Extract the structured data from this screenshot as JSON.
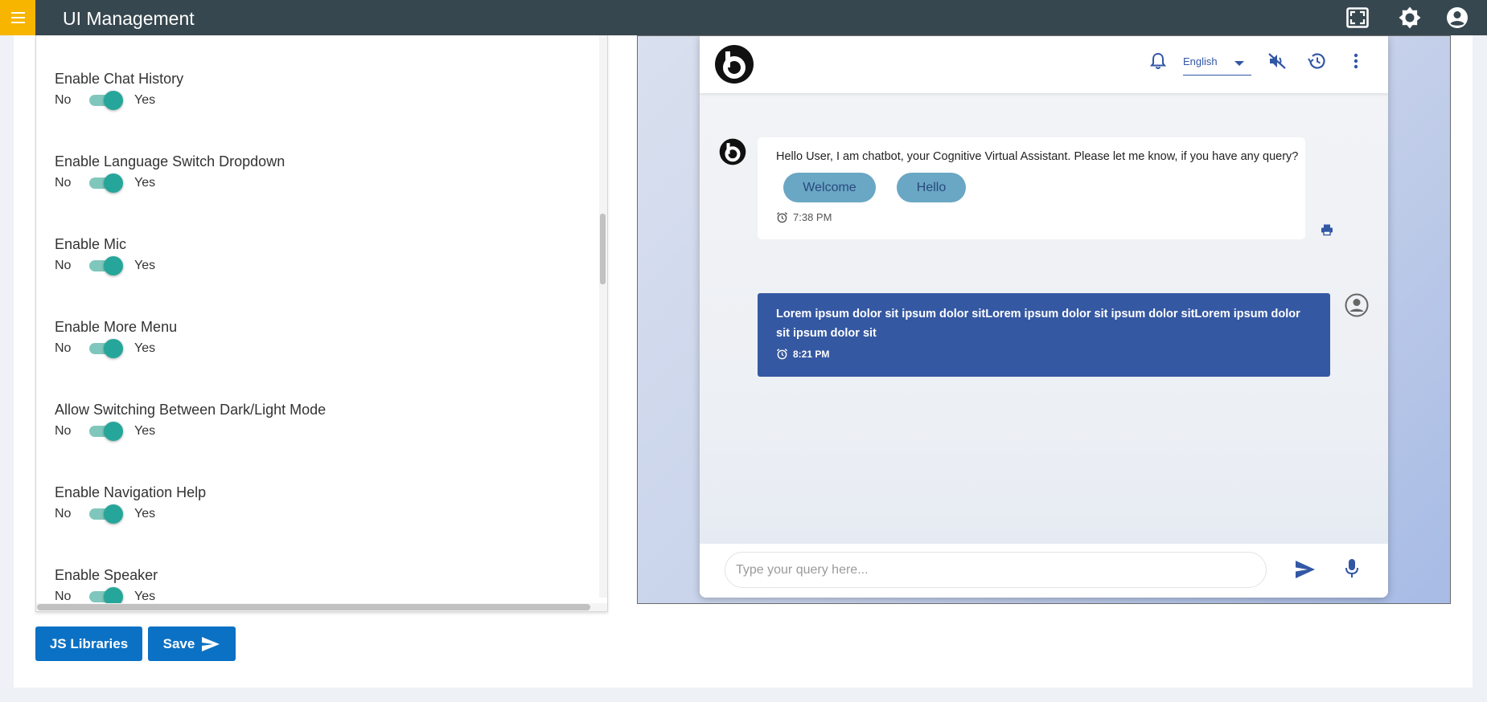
{
  "header": {
    "title": "UI Management",
    "icons": [
      "menu-icon",
      "fullscreen-icon",
      "brightness-icon",
      "account-icon"
    ]
  },
  "settings": {
    "no_label": "No",
    "yes_label": "Yes",
    "items": [
      {
        "label": "Enable Chat History",
        "enabled": true
      },
      {
        "label": "Enable Language Switch Dropdown",
        "enabled": true
      },
      {
        "label": "Enable Mic",
        "enabled": true
      },
      {
        "label": "Enable More Menu",
        "enabled": true
      },
      {
        "label": "Allow Switching Between Dark/Light Mode",
        "enabled": true
      },
      {
        "label": "Enable Navigation Help",
        "enabled": true
      },
      {
        "label": "Enable Speaker",
        "enabled": true
      }
    ]
  },
  "actions": {
    "js_libraries_label": "JS Libraries",
    "save_label": "Save"
  },
  "chat": {
    "language": "English",
    "bot_message": "Hello User, I am chatbot, your Cognitive Virtual Assistant. Please let me know, if you have any query?",
    "chips": [
      "Welcome",
      "Hello"
    ],
    "bot_time": "7:38 PM",
    "user_message": "Lorem ipsum dolor sit ipsum dolor sitLorem ipsum dolor sit ipsum dolor sitLorem ipsum dolor sit ipsum dolor sit",
    "user_time": "8:21 PM",
    "input_placeholder": "Type your query here...",
    "icons": [
      "brand-logo-icon",
      "bell-icon",
      "speaker-muted-icon",
      "history-icon",
      "more-vert-icon",
      "print-icon",
      "user-avatar-icon",
      "send-icon",
      "mic-icon",
      "alarm-clock-icon"
    ]
  },
  "colors": {
    "topbar": "#37474f",
    "menu_button": "#f7b500",
    "toggle_on": "#26a69a",
    "primary_button": "#0b71c4",
    "user_bubble": "#3558a2",
    "chip": "#6aa7c4",
    "chat_accent": "#3257a5"
  }
}
